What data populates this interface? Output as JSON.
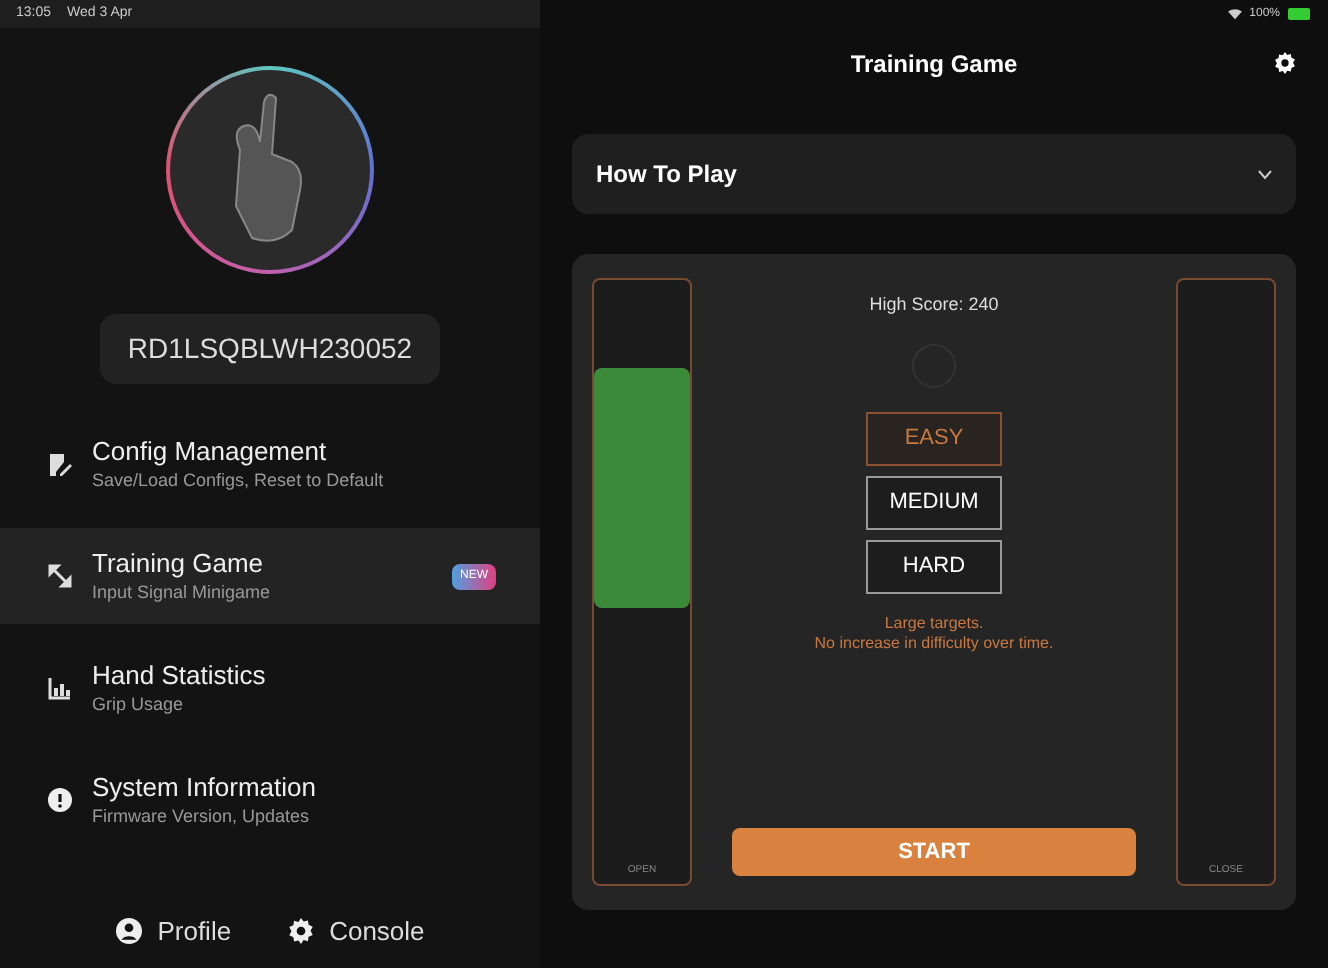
{
  "status_bar": {
    "time": "13:05",
    "date": "Wed 3 Apr",
    "battery": "100%"
  },
  "sidebar": {
    "serial": "RD1LSQBLWH230052",
    "items": [
      {
        "title": "Config Management",
        "subtitle": "Save/Load Configs, Reset to Default",
        "selected": false
      },
      {
        "title": "Training Game",
        "subtitle": "Input Signal Minigame",
        "selected": true,
        "badge": "NEW"
      },
      {
        "title": "Hand Statistics",
        "subtitle": "Grip Usage",
        "selected": false
      },
      {
        "title": "System Information",
        "subtitle": "Firmware Version, Updates",
        "selected": false
      }
    ],
    "footer": [
      {
        "label": "Profile"
      },
      {
        "label": "Console"
      }
    ]
  },
  "header": {
    "title": "Training Game"
  },
  "how_to_play": {
    "label": "How To Play",
    "expanded": false
  },
  "game": {
    "high_score": "High Score: 240",
    "difficulties": [
      {
        "label": "EASY",
        "selected": true
      },
      {
        "label": "MEDIUM",
        "selected": false
      },
      {
        "label": "HARD",
        "selected": false
      }
    ],
    "hint": [
      "Large targets.",
      "No increase in difficulty over time."
    ],
    "start": "START",
    "left_meter_label": "OPEN",
    "right_meter_label": "CLOSE"
  }
}
